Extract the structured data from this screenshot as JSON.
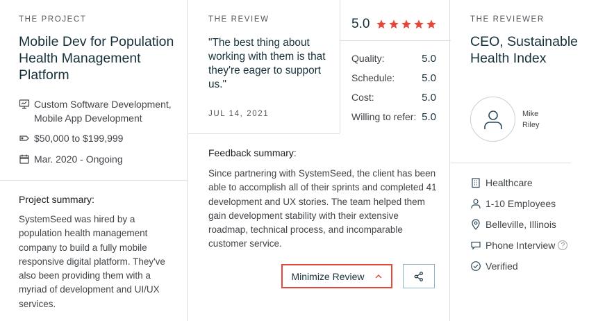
{
  "project": {
    "eyebrow": "THE PROJECT",
    "title": "Mobile Dev for Population Health Management Platform",
    "services": "Custom Software Development, Mobile App Development",
    "budget": "$50,000 to $199,999",
    "timeline": "Mar. 2020 - Ongoing",
    "summary_title": "Project summary:",
    "summary": "SystemSeed was hired by a population health management company to build a fully mobile responsive digital platform. They've also been providing them with a myriad of development and UI/UX services."
  },
  "review": {
    "eyebrow": "THE REVIEW",
    "quote": "\"The best thing about working with them is that they're eager to support us.\"",
    "date": "JUL 14, 2021",
    "overall": "5.0",
    "stars": 5,
    "scores": [
      {
        "label": "Quality:",
        "value": "5.0"
      },
      {
        "label": "Schedule:",
        "value": "5.0"
      },
      {
        "label": "Cost:",
        "value": "5.0"
      },
      {
        "label": "Willing to refer:",
        "value": "5.0"
      }
    ],
    "feedback_title": "Feedback summary:",
    "feedback": "Since partnering with SystemSeed, the client has been able to accomplish all of their sprints and completed 41 development and UX stories. The team helped them gain development stability with their extensive roadmap, technical process, and incomparable customer service.",
    "minimize_label": "Minimize Review"
  },
  "reviewer": {
    "eyebrow": "THE REVIEWER",
    "title": "CEO, Sustainable Health Index",
    "name": "Mike Riley",
    "industry": "Healthcare",
    "employees": "1-10 Employees",
    "location": "Belleville, Illinois",
    "interview": "Phone Interview",
    "verified": "Verified"
  },
  "colors": {
    "accent_red": "#e5473d",
    "share_border": "#8fb3c4",
    "divider": "#d8dde3"
  }
}
